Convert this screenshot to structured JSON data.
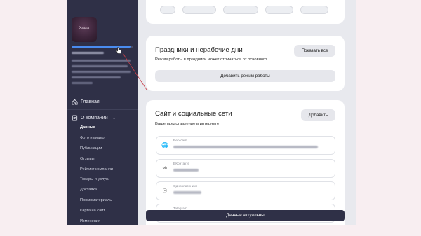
{
  "colors": {
    "sidebar_bg": "#2f3047",
    "progress": "#4a8cf0",
    "page_bg": "#f8eef1",
    "annotation": "#c9404a"
  },
  "sidebar": {
    "logo_text": "Хадаш",
    "profile_progress": 0.95,
    "nav": [
      {
        "label": "Главная",
        "icon": "home-icon"
      },
      {
        "label": "О компании",
        "icon": "document-icon",
        "expanded": true
      }
    ],
    "subitems": [
      "Данные",
      "Фото и видео",
      "Публикации",
      "Отзывы",
      "Рейтинг компании",
      "Товары и услуги",
      "Доставка",
      "Промоматериалы",
      "Карта на сайт",
      "Изменения"
    ],
    "active_subitem": "Данные"
  },
  "holidays": {
    "title": "Праздники и нерабочие дни",
    "show_all": "Показать все",
    "note": "Режим работы в праздники может отличаться от основного",
    "add": "Добавить режим работы"
  },
  "site": {
    "title": "Сайт и социальные сети",
    "add": "Добавить",
    "subtitle": "Ваше представление в интернете",
    "fields": [
      {
        "label": "Веб-сайт",
        "icon": "globe-icon"
      },
      {
        "label": "ВКонтакте",
        "icon": "vk-icon"
      },
      {
        "label": "Одноклассники",
        "icon": "ok-icon"
      },
      {
        "label": "Telegram",
        "icon": "telegram-icon"
      }
    ]
  },
  "footer": {
    "button": "Данные актуальны"
  }
}
